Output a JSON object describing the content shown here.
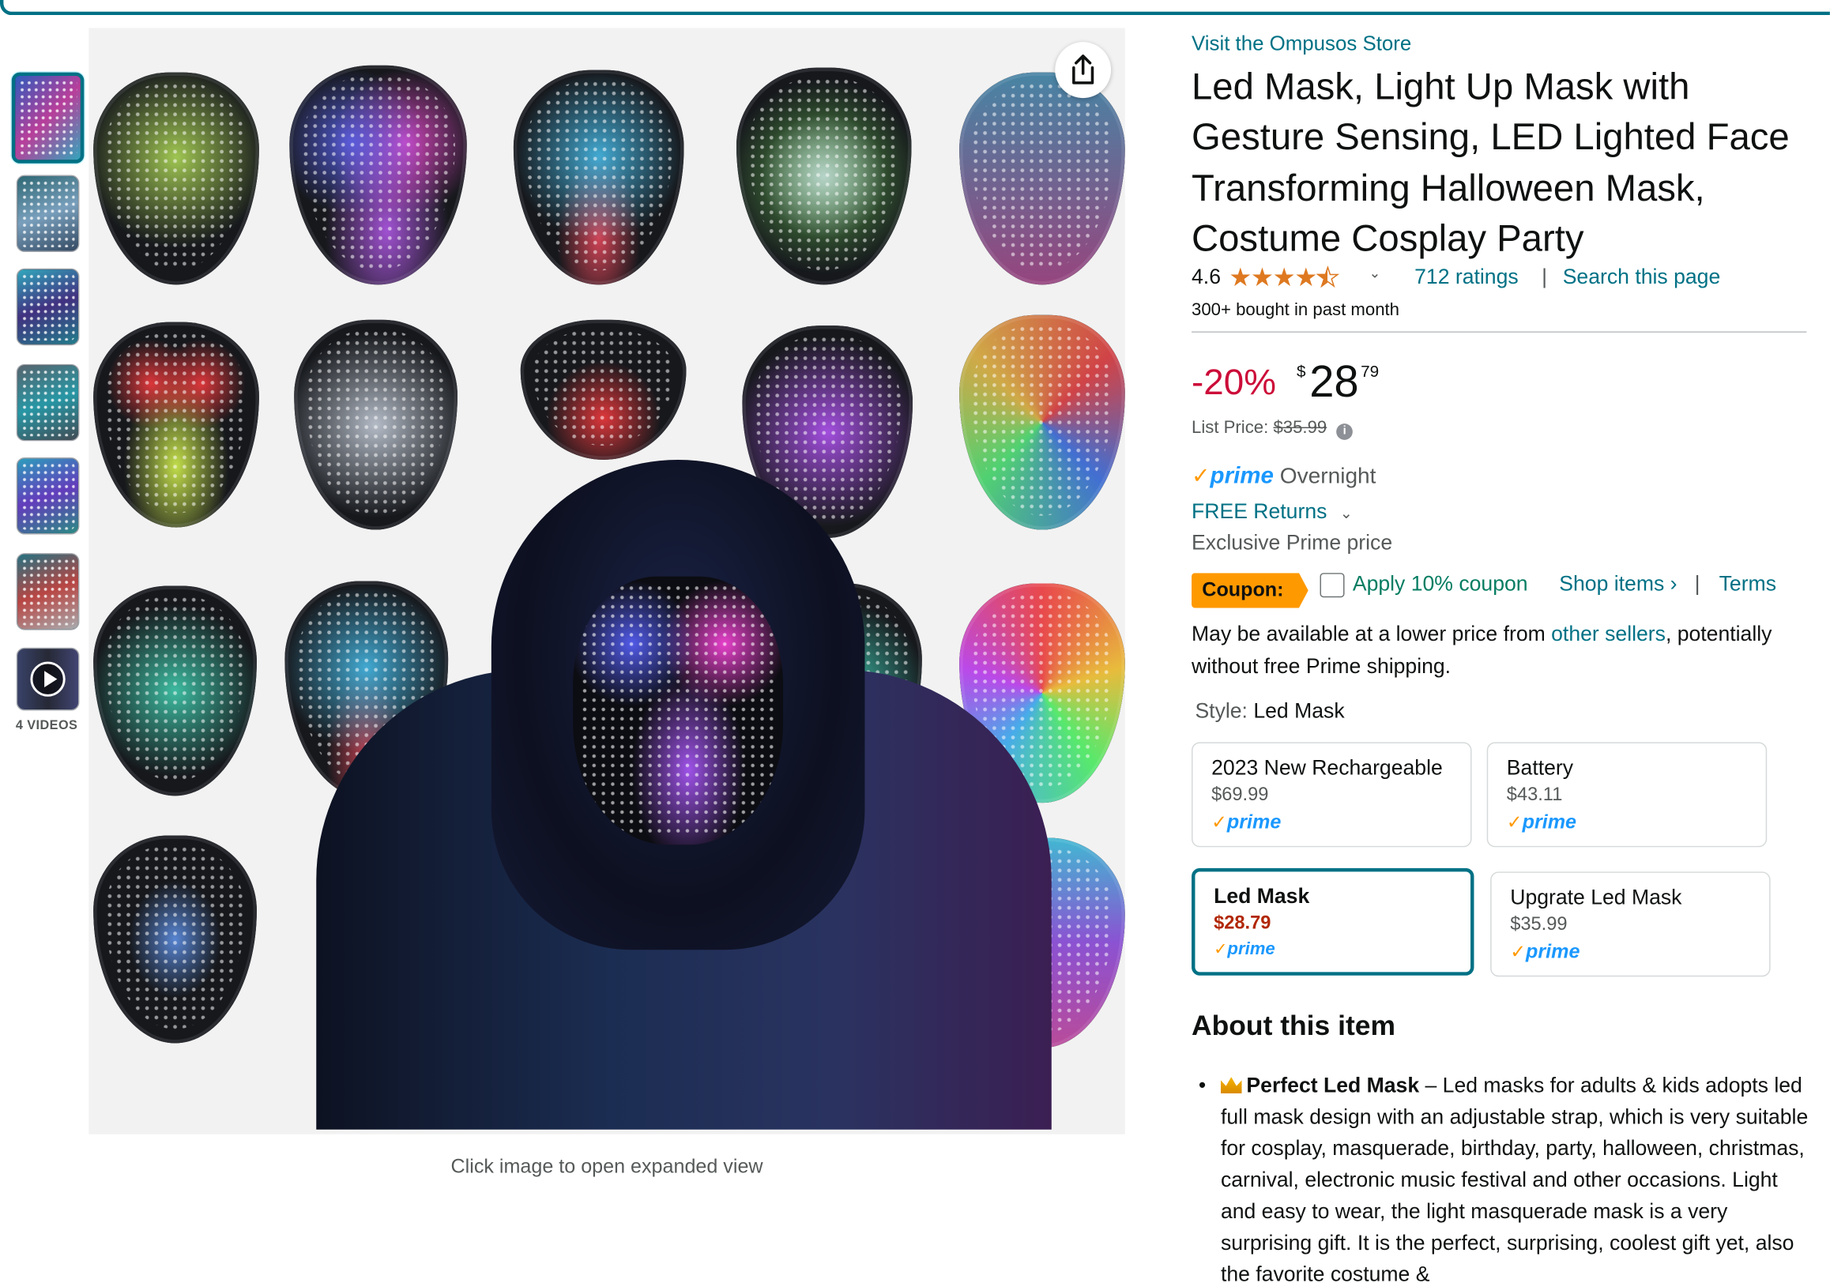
{
  "thumbnails": {
    "count": 7,
    "selected_index": 0,
    "videos_label": "4 VIDEOS"
  },
  "main_image": {
    "caption": "Click image to open expanded view",
    "share_icon": "share-icon"
  },
  "product": {
    "store_link": "Visit the Ompusos Store",
    "title": "Led Mask, Light Up Mask with Gesture Sensing, LED Lighted Face Transforming Halloween Mask, Costume Cosplay Party",
    "rating": "4.6",
    "stars": 4.5,
    "ratings_count": "712 ratings",
    "search_page": "Search this page",
    "bought": "300+ bought in past month"
  },
  "price": {
    "discount": "-20%",
    "currency": "$",
    "whole": "28",
    "fraction": "79",
    "list_price_label": "List Price:",
    "list_price": "$35.99"
  },
  "delivery": {
    "prime_check": "✓",
    "prime_word": "prime",
    "prime_speed": "Overnight",
    "returns": "FREE Returns",
    "exclusive": "Exclusive Prime price"
  },
  "coupon": {
    "badge": "Coupon:",
    "apply": "Apply 10% coupon",
    "shop_items": "Shop items ›",
    "separator": "|",
    "terms": "Terms"
  },
  "availability": {
    "pre": "May be available at a lower price from ",
    "link": "other sellers",
    "post": ", potentially without free Prime shipping."
  },
  "style": {
    "label": "Style: ",
    "selected": "Led Mask",
    "options": [
      {
        "name": "2023 New Rechargeable",
        "price": "$69.99",
        "prime": "prime"
      },
      {
        "name": "Battery",
        "price": "$43.11",
        "prime": "prime"
      },
      {
        "name": "Led Mask",
        "price": "$28.79",
        "prime": "prime"
      },
      {
        "name": "Upgrate Led Mask",
        "price": "$35.99",
        "prime": "prime"
      }
    ]
  },
  "about": {
    "heading": "About this item",
    "bullets": [
      {
        "title": "Perfect Led Mask",
        "text": " – Led masks for adults & kids adopts led full mask design with an adjustable strap, which is very suitable for cosplay, masquerade, birthday, party, halloween, christmas, carnival, electronic music festival and other occasions. Light and easy to wear, the light masquerade mask is a very surprising gift. It is the perfect, surprising, coolest gift yet, also the favorite costume &"
      }
    ]
  },
  "colors": {
    "link": "#007185",
    "discount": "#cc0c39",
    "prime_blue": "#1a98ff",
    "prime_check": "#ff9900",
    "coupon_badge": "#ff9900",
    "coupon_text": "#067d62",
    "selected_price": "#b12704"
  }
}
